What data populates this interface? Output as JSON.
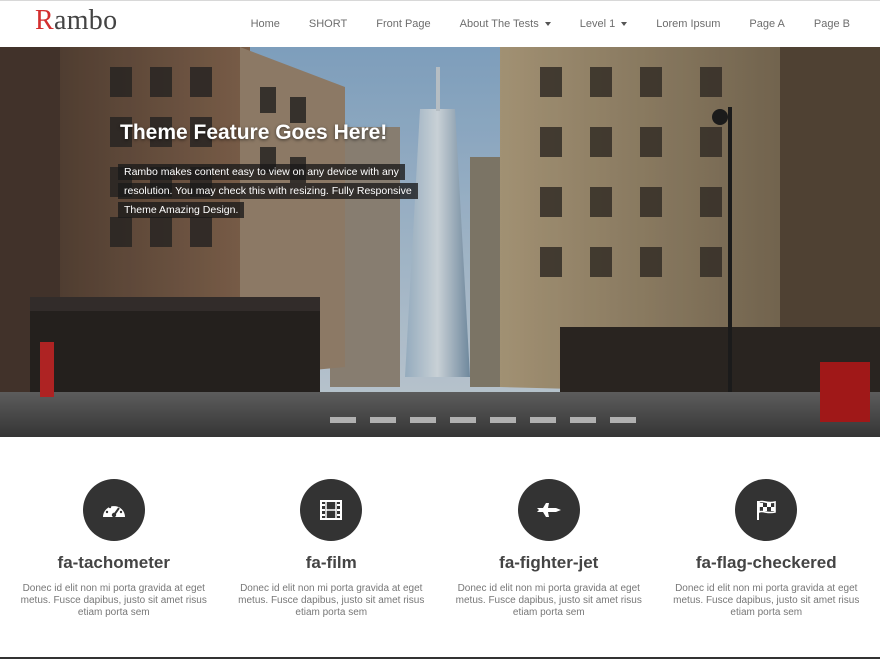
{
  "brand": {
    "logo_first": "R",
    "logo_rest": "ambo",
    "accent_color": "#d32f2f"
  },
  "nav": {
    "items": [
      {
        "label": "Home"
      },
      {
        "label": "SHORT"
      },
      {
        "label": "Front Page"
      },
      {
        "label": "About The Tests",
        "dropdown": true
      },
      {
        "label": "Level 1",
        "dropdown": true
      },
      {
        "label": "Lorem Ipsum"
      },
      {
        "label": "Page A"
      },
      {
        "label": "Page B"
      }
    ]
  },
  "hero": {
    "title": "Theme Feature Goes Here!",
    "description": "Rambo makes content easy to view on any device with any resolution. You may check this with resizing. Fully Responsive Theme Amazing Design.",
    "image": "city street with skyscrapers"
  },
  "features": [
    {
      "icon": "tachometer-icon",
      "title": "fa-tachometer",
      "text": "Donec id elit non mi porta gravida at eget metus. Fusce dapibus, justo sit amet risus etiam porta sem"
    },
    {
      "icon": "film-icon",
      "title": "fa-film",
      "text": "Donec id elit non mi porta gravida at eget metus. Fusce dapibus, justo sit amet risus etiam porta sem"
    },
    {
      "icon": "fighter-jet-icon",
      "title": "fa-fighter-jet",
      "text": "Donec id elit non mi porta gravida at eget metus. Fusce dapibus, justo sit amet risus etiam porta sem"
    },
    {
      "icon": "flag-checkered-icon",
      "title": "fa-flag-checkered",
      "text": "Donec id elit non mi porta gravida at eget metus. Fusce dapibus, justo sit amet risus etiam porta sem"
    }
  ]
}
